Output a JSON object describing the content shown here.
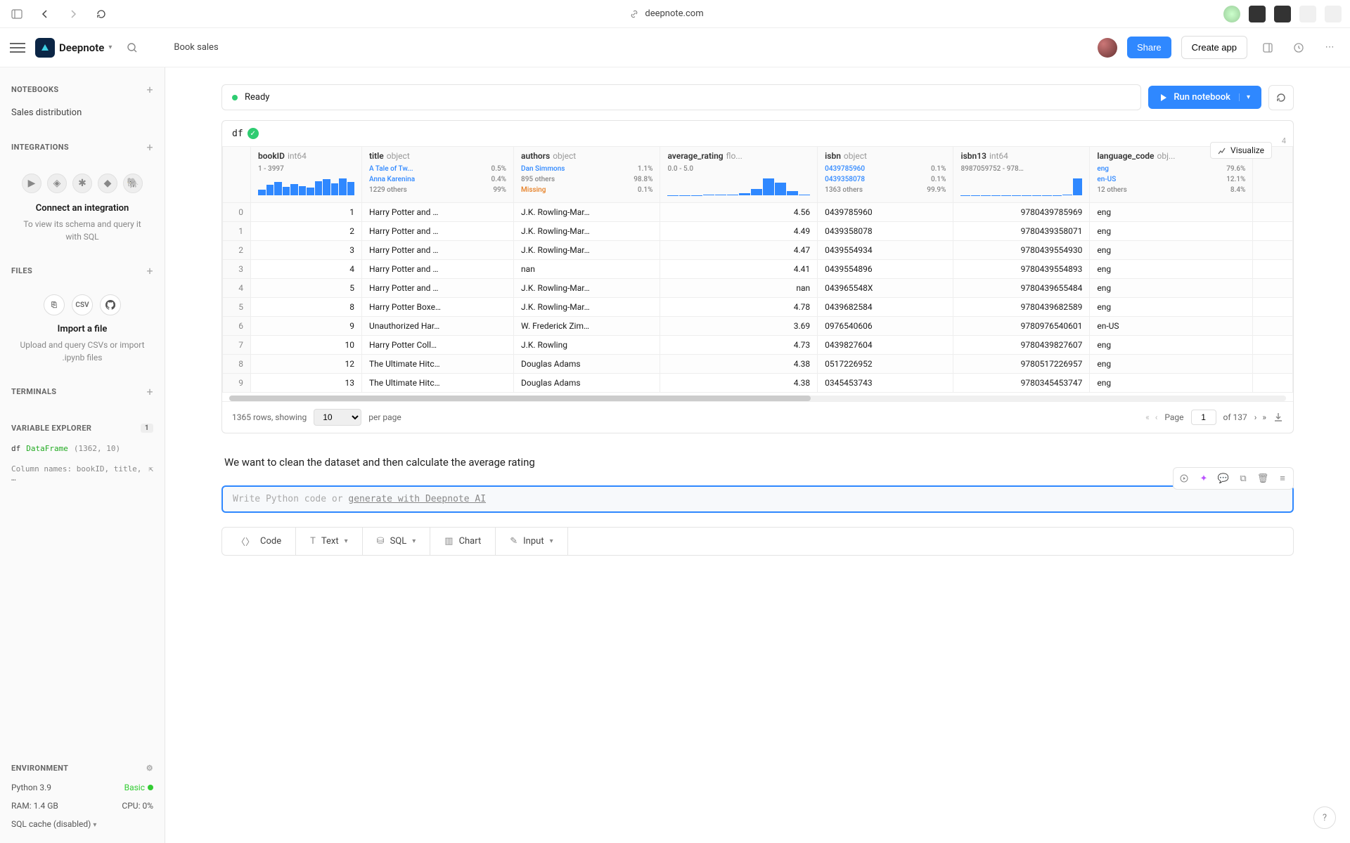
{
  "browser": {
    "url": "deepnote.com"
  },
  "app": {
    "name": "Deepnote",
    "breadcrumb": "Book sales",
    "share": "Share",
    "create_app": "Create app"
  },
  "sidebar": {
    "notebooks": {
      "title": "Notebooks",
      "items": [
        "Sales distribution"
      ]
    },
    "integrations": {
      "title": "Integrations",
      "cta": "Connect an integration",
      "desc": "To view its schema and query it with SQL"
    },
    "files": {
      "title": "Files",
      "cta": "Import a file",
      "desc": "Upload and query CSVs or import .ipynb files"
    },
    "terminals": {
      "title": "Terminals"
    },
    "variable_explorer": {
      "title": "Variable Explorer",
      "count": "1",
      "var_name": "df",
      "var_type": "DataFrame",
      "var_shape": "(1362, 10)",
      "var_cols": "Column names: bookID, title, …"
    },
    "environment": {
      "title": "Environment",
      "python": "Python 3.9",
      "plan": "Basic",
      "ram": "RAM: 1.4 GB",
      "cpu": "CPU: 0%",
      "sql_cache": "SQL cache (disabled)"
    }
  },
  "notebook": {
    "status": "Ready",
    "run": "Run notebook",
    "df_name": "df",
    "visualize": "Visualize",
    "count_badge": "4",
    "columns": [
      {
        "name": "bookID",
        "type": "int64",
        "range": "1 - 3997",
        "hist": [
          30,
          55,
          70,
          45,
          60,
          50,
          40,
          75,
          85,
          65,
          90,
          70
        ]
      },
      {
        "name": "title",
        "type": "object",
        "stats": [
          {
            "label": "A Tale of Tw...",
            "pct": "0.5%",
            "link": true
          },
          {
            "label": "Anna Karenina",
            "pct": "0.4%",
            "link": true
          },
          {
            "label": "1229 others",
            "pct": "99%"
          }
        ]
      },
      {
        "name": "authors",
        "type": "object",
        "stats": [
          {
            "label": "Dan Simmons",
            "pct": "1.1%",
            "link": true
          },
          {
            "label": "895 others",
            "pct": "98.8%"
          },
          {
            "label": "Missing",
            "pct": "0.1%",
            "missing": true
          }
        ]
      },
      {
        "name": "average_rating",
        "type": "flo...",
        "range": "0.0 - 5.0",
        "hist": [
          1,
          1,
          1,
          2,
          3,
          5,
          10,
          30,
          80,
          60,
          20,
          5
        ]
      },
      {
        "name": "isbn",
        "type": "object",
        "stats": [
          {
            "label": "0439785960",
            "pct": "0.1%",
            "link": true
          },
          {
            "label": "0439358078",
            "pct": "0.1%",
            "link": true
          },
          {
            "label": "1363 others",
            "pct": "99.9%"
          }
        ]
      },
      {
        "name": "isbn13",
        "type": "int64",
        "range": "8987059752 - 978…",
        "hist": [
          1,
          1,
          1,
          1,
          1,
          1,
          1,
          1,
          1,
          1,
          5,
          95
        ]
      },
      {
        "name": "language_code",
        "type": "obj...",
        "stats": [
          {
            "label": "eng",
            "pct": "79.6%",
            "link": true
          },
          {
            "label": "en-US",
            "pct": "12.1%",
            "link": true
          },
          {
            "label": "12 others",
            "pct": "8.4%"
          }
        ]
      },
      {
        "name": "#",
        "type": ""
      }
    ],
    "rows": [
      {
        "idx": "0",
        "bookID": "1",
        "title": "Harry Potter and …",
        "authors": "J.K. Rowling-Mar…",
        "rating": "4.56",
        "isbn": "0439785960",
        "isbn13": "9780439785969",
        "lang": "eng"
      },
      {
        "idx": "1",
        "bookID": "2",
        "title": "Harry Potter and …",
        "authors": "J.K. Rowling-Mar…",
        "rating": "4.49",
        "isbn": "0439358078",
        "isbn13": "9780439358071",
        "lang": "eng"
      },
      {
        "idx": "2",
        "bookID": "3",
        "title": "Harry Potter and …",
        "authors": "J.K. Rowling-Mar…",
        "rating": "4.47",
        "isbn": "0439554934",
        "isbn13": "9780439554930",
        "lang": "eng"
      },
      {
        "idx": "3",
        "bookID": "4",
        "title": "Harry Potter and …",
        "authors": "nan",
        "rating": "4.41",
        "isbn": "0439554896",
        "isbn13": "9780439554893",
        "lang": "eng"
      },
      {
        "idx": "4",
        "bookID": "5",
        "title": "Harry Potter and …",
        "authors": "J.K. Rowling-Mar…",
        "rating": "nan",
        "isbn": "043965548X",
        "isbn13": "9780439655484",
        "lang": "eng"
      },
      {
        "idx": "5",
        "bookID": "8",
        "title": "Harry Potter Boxe…",
        "authors": "J.K. Rowling-Mar…",
        "rating": "4.78",
        "isbn": "0439682584",
        "isbn13": "9780439682589",
        "lang": "eng"
      },
      {
        "idx": "6",
        "bookID": "9",
        "title": "Unauthorized Har…",
        "authors": "W. Frederick Zim…",
        "rating": "3.69",
        "isbn": "0976540606",
        "isbn13": "9780976540601",
        "lang": "en-US"
      },
      {
        "idx": "7",
        "bookID": "10",
        "title": "Harry Potter Coll…",
        "authors": "J.K. Rowling",
        "rating": "4.73",
        "isbn": "0439827604",
        "isbn13": "9780439827607",
        "lang": "eng"
      },
      {
        "idx": "8",
        "bookID": "12",
        "title": "The Ultimate Hitc…",
        "authors": "Douglas Adams",
        "rating": "4.38",
        "isbn": "0517226952",
        "isbn13": "9780517226957",
        "lang": "eng"
      },
      {
        "idx": "9",
        "bookID": "13",
        "title": "The Ultimate Hitc…",
        "authors": "Douglas Adams",
        "rating": "4.38",
        "isbn": "0345453743",
        "isbn13": "9780345453747",
        "lang": "eng"
      }
    ],
    "pagination": {
      "rows_label": "1365 rows, showing",
      "per_page": "10",
      "per_page_suffix": "per page",
      "page_label": "Page",
      "page": "1",
      "of": "of 137"
    },
    "markdown": "We want to clean the dataset and then calculate the average rating",
    "code_placeholder_prefix": "Write Python code or ",
    "code_placeholder_link": "generate with Deepnote AI",
    "blocks": {
      "code": "Code",
      "text": "Text",
      "sql": "SQL",
      "chart": "Chart",
      "input": "Input"
    }
  }
}
